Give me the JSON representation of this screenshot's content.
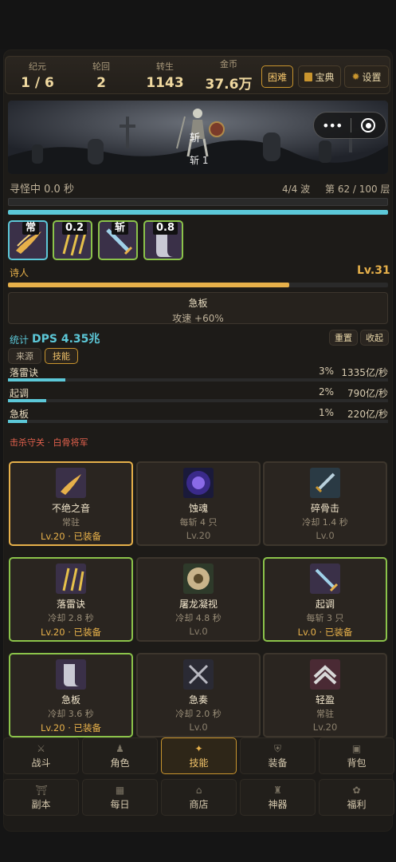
{
  "stats": [
    {
      "label": "纪元",
      "value": "1 / 6"
    },
    {
      "label": "轮回",
      "value": "2"
    },
    {
      "label": "转生",
      "value": "1143"
    },
    {
      "label": "金币",
      "value": "37.6万"
    }
  ],
  "top_buttons": {
    "difficulty": "困难",
    "codex": "宝典",
    "settings": "设置"
  },
  "banner": {
    "enemy_tag": "斩",
    "enemy_caption": "斩 1"
  },
  "status": {
    "searching": "寻怪中 0.0 秒",
    "wave": "4/4 波",
    "floor": "第 62 / 100 层",
    "progress": 1.0
  },
  "quick_skills": [
    {
      "chip": "常"
    },
    {
      "chip": "0.2"
    },
    {
      "chip": "斩"
    },
    {
      "chip": "0.8"
    }
  ],
  "hero": {
    "class": "诗人",
    "level": "Lv.31",
    "xp_progress": 0.74
  },
  "buff": {
    "title": "急板",
    "effect": "攻速 +60%"
  },
  "dps": {
    "label": "统计",
    "value": "DPS 4.35兆",
    "reset": "重置",
    "collapse": "收起",
    "tabs": [
      "来源",
      "技能"
    ],
    "active_tab": "技能"
  },
  "dps_rows": [
    {
      "name": "落雷诀",
      "pct": "3%",
      "amount": "1335亿/秒",
      "share": 0.03
    },
    {
      "name": "起调",
      "pct": "2%",
      "amount": "790亿/秒",
      "share": 0.02
    },
    {
      "name": "急板",
      "pct": "1%",
      "amount": "220亿/秒",
      "share": 0.01
    }
  ],
  "kill_note": "击杀守关 · 白骨将军",
  "skills": [
    {
      "name": "不绝之音",
      "sub": "常驻",
      "lv": "Lv.20 · 已装备",
      "state": "gold",
      "icon": "wings-icon"
    },
    {
      "name": "蚀魂",
      "sub": "每斩 4 只",
      "lv": "Lv.20",
      "state": "none",
      "icon": "soul-orb-icon"
    },
    {
      "name": "碎骨击",
      "sub": "冷却 1.4 秒",
      "lv": "Lv.0",
      "state": "none",
      "icon": "sword-icon"
    },
    {
      "name": "落雷诀",
      "sub": "冷却 2.8 秒",
      "lv": "Lv.20 · 已装备",
      "state": "green",
      "icon": "lightning-rods-icon"
    },
    {
      "name": "屠龙凝视",
      "sub": "冷却 4.8 秒",
      "lv": "Lv.0",
      "state": "none",
      "icon": "eye-icon"
    },
    {
      "name": "起调",
      "sub": "每斩 3 只",
      "lv": "Lv.0 · 已装备",
      "state": "green",
      "icon": "slash-sword-icon"
    },
    {
      "name": "急板",
      "sub": "冷却 3.6 秒",
      "lv": "Lv.20 · 已装备",
      "state": "green",
      "icon": "scroll-icon"
    },
    {
      "name": "急奏",
      "sub": "冷却 2.0 秒",
      "lv": "Lv.0",
      "state": "none",
      "icon": "crossed-swords-icon"
    },
    {
      "name": "轻盈",
      "sub": "常驻",
      "lv": "Lv.20",
      "state": "none",
      "icon": "chevrons-icon"
    }
  ],
  "nav": [
    {
      "label": "战斗",
      "icon": "swords-icon"
    },
    {
      "label": "角色",
      "icon": "person-icon"
    },
    {
      "label": "技能",
      "icon": "spark-icon"
    },
    {
      "label": "装备",
      "icon": "armor-icon"
    },
    {
      "label": "背包",
      "icon": "bag-icon"
    },
    {
      "label": "副本",
      "icon": "gate-icon"
    },
    {
      "label": "每日",
      "icon": "calendar-icon"
    },
    {
      "label": "商店",
      "icon": "shop-icon"
    },
    {
      "label": "神器",
      "icon": "artifact-icon"
    },
    {
      "label": "福利",
      "icon": "gift-icon"
    }
  ],
  "nav_active": "技能",
  "colors": {
    "gold": "#e6b04a",
    "green": "#8bc34a",
    "cyan": "#5cc8d8",
    "red": "#e0604c"
  }
}
